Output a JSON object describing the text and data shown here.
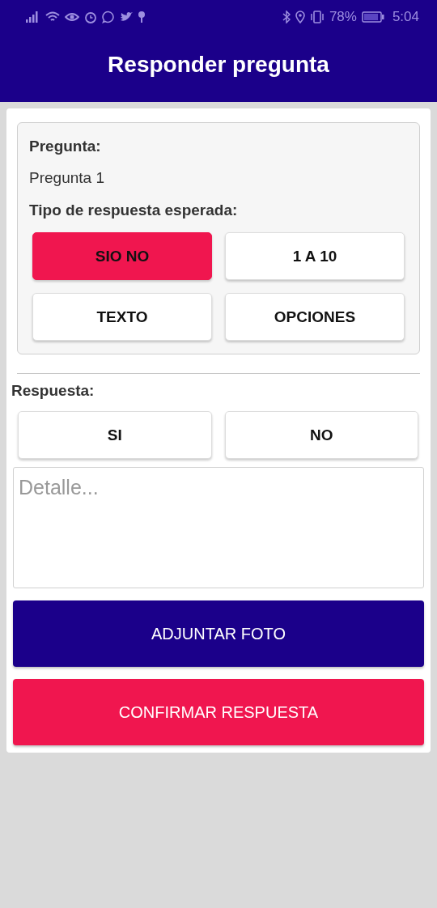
{
  "status_bar": {
    "battery": "78%",
    "time": "5:04"
  },
  "app_bar": {
    "title": "Responder pregunta"
  },
  "question": {
    "label": "Pregunta:",
    "text": "Pregunta 1",
    "type_label": "Tipo de respuesta esperada:",
    "types": [
      {
        "label": "SIO NO",
        "selected": true
      },
      {
        "label": "1 A 10",
        "selected": false
      },
      {
        "label": "TEXTO",
        "selected": false
      },
      {
        "label": "OPCIONES",
        "selected": false
      }
    ]
  },
  "answer": {
    "label": "Respuesta:",
    "options": [
      {
        "label": "SI",
        "selected": false
      },
      {
        "label": "NO",
        "selected": false
      }
    ],
    "detail": {
      "placeholder": "Detalle..."
    }
  },
  "buttons": [
    {
      "label": "ADJUNTAR FOTO",
      "kind": "secondary"
    },
    {
      "label": "CONFIRMAR RESPUESTA",
      "kind": "primary"
    }
  ]
}
